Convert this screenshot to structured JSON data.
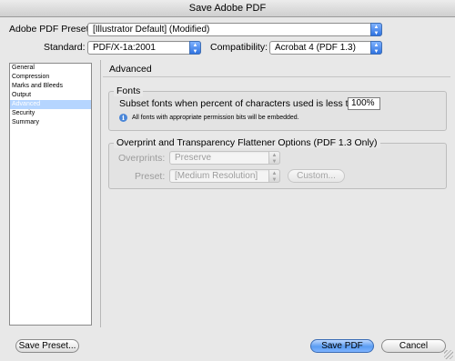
{
  "window": {
    "title": "Save Adobe PDF"
  },
  "preset": {
    "label": "Adobe PDF Preset:",
    "value": "[Illustrator Default] (Modified)"
  },
  "standard": {
    "label": "Standard:",
    "value": "PDF/X-1a:2001"
  },
  "compatibility": {
    "label": "Compatibility:",
    "value": "Acrobat 4 (PDF 1.3)"
  },
  "sidebar": {
    "items": [
      {
        "label": "General"
      },
      {
        "label": "Compression"
      },
      {
        "label": "Marks and Bleeds"
      },
      {
        "label": "Output"
      },
      {
        "label": "Advanced",
        "selected": true
      },
      {
        "label": "Security"
      },
      {
        "label": "Summary"
      }
    ]
  },
  "panel": {
    "title": "Advanced",
    "fonts": {
      "legend": "Fonts",
      "subset_label": "Subset fonts when percent of characters used is less than:",
      "subset_value": "100%",
      "info_text": "All fonts with appropriate permission bits will be embedded."
    },
    "overprint": {
      "legend": "Overprint and Transparency Flattener Options (PDF 1.3 Only)",
      "overprints_label": "Overprints:",
      "overprints_value": "Preserve",
      "preset_label": "Preset:",
      "preset_value": "[Medium Resolution]",
      "custom_label": "Custom..."
    }
  },
  "buttons": {
    "save_preset": "Save Preset...",
    "save_pdf": "Save PDF",
    "cancel": "Cancel"
  },
  "colors": {
    "accent": "#3f7fe0",
    "selection": "#b5d5ff"
  }
}
